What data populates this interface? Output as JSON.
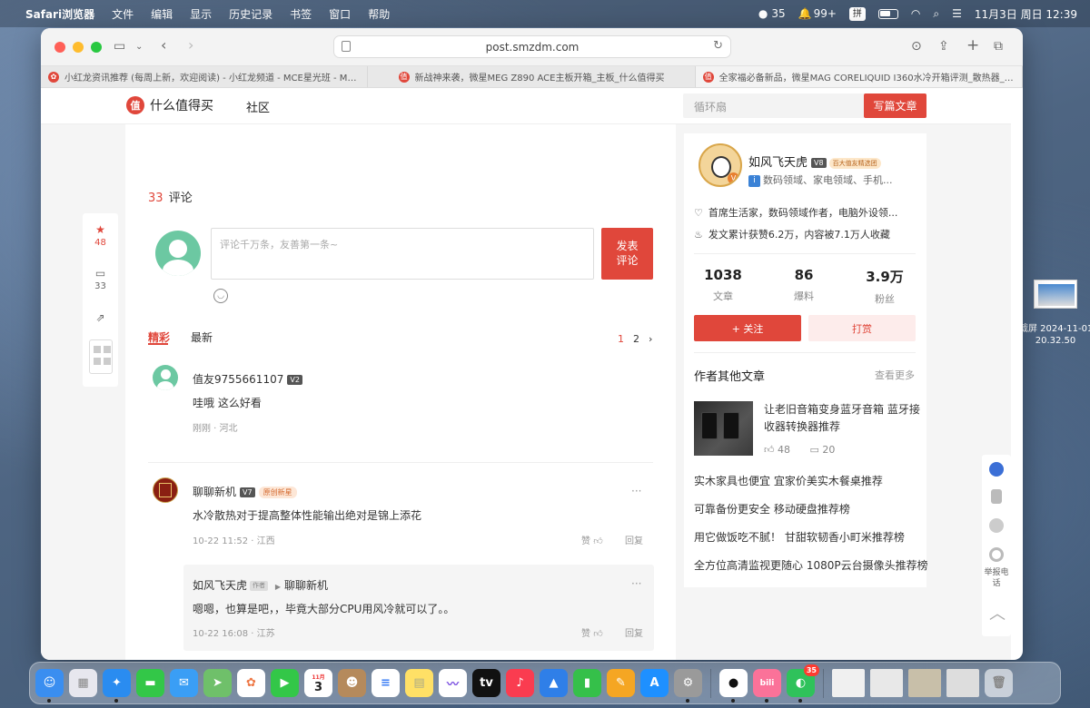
{
  "menubar": {
    "app": "Safari浏览器",
    "items": [
      "文件",
      "编辑",
      "显示",
      "历史记录",
      "书签",
      "窗口",
      "帮助"
    ],
    "wechat_count": "35",
    "notif_count": "99+",
    "ime": "拼",
    "datetime": "11月3日 周日  12:39"
  },
  "browser": {
    "url": "post.smzdm.com",
    "tabs": [
      {
        "title": "小红龙资讯推荐 (每周上新，欢迎阅读) - 小红龙频道 - MCE星光班 - MSI..."
      },
      {
        "title": "新战神来袭，微星MEG Z890 ACE主板开箱_主板_什么值得买"
      },
      {
        "title": "全家福必备新品，微星MAG CORELIQUID I360水冷开箱评测_散热器_什..."
      }
    ]
  },
  "site": {
    "logo_char": "值",
    "logo_text": "什么值得买",
    "nav_community": "社区",
    "search_placeholder": "循环扇",
    "write_button": "写篇文章"
  },
  "floatbar": {
    "like_count": "48",
    "comment_count": "33"
  },
  "comments": {
    "count": "33",
    "title": "评论",
    "input_placeholder": "评论千万条，友善第一条~",
    "post_button_line1": "发表",
    "post_button_line2": "评论",
    "tab_featured": "精彩",
    "tab_latest": "最新",
    "pages": [
      "1",
      "2"
    ],
    "items": [
      {
        "user": "值友9755661107",
        "level": "V2",
        "text": "哇哦 这么好看",
        "meta": "刚刚 · 河北"
      },
      {
        "user": "聊聊新机",
        "level": "V7",
        "badge": "原创新星",
        "text": "水冷散热对于提高整体性能输出绝对是锦上添花",
        "meta": "10-22 11:52 · 江西",
        "like": "赞",
        "reply": "回复"
      }
    ],
    "reply": {
      "user": "如风飞天虎",
      "author_tag": "作者",
      "to_user": "聊聊新机",
      "text": "嗯嗯，也算是吧，，毕竟大部分CPU用风冷就可以了。。",
      "meta": "10-22 16:08 · 江苏",
      "like": "赞",
      "reply": "回复"
    }
  },
  "author": {
    "name": "如风飞天虎",
    "level": "V8",
    "badge": "百大值友精选团",
    "fields": "数码领域、家电领域、手机...",
    "desc": "首席生活家，数码领域作者，电脑外设领...",
    "likes": "发文累计获赞6.2万，内容被7.1万人收藏",
    "stats": [
      {
        "value": "1038",
        "label": "文章"
      },
      {
        "value": "86",
        "label": "爆料"
      },
      {
        "value": "3.9万",
        "label": "粉丝"
      }
    ],
    "follow_button": "+ 关注",
    "reward_button": "打赏"
  },
  "other_articles": {
    "title": "作者其他文章",
    "more": "查看更多",
    "featured": {
      "title": "让老旧音箱变身蓝牙音箱 蓝牙接收器转换器推荐",
      "likes": "48",
      "comments": "20"
    },
    "list": [
      "实木家具也便宜 宜家价美实木餐桌推荐",
      "可靠备份更安全 移动硬盘推荐榜",
      "用它做饭吃不腻！ 甘甜软韧香小町米推荐榜",
      "全方位高清监视更随心 1080P云台摄像头推荐榜"
    ]
  },
  "right_float": {
    "report_label": "举报电话"
  },
  "desktop": {
    "screenshot_label_1": "截屏 2024-11-01",
    "screenshot_label_2": "20.32.50"
  },
  "dock": {
    "calendar_month": "11月",
    "calendar_day": "3",
    "wechat_badge": "35"
  },
  "colors": {
    "brand_red": "#e0473b"
  }
}
